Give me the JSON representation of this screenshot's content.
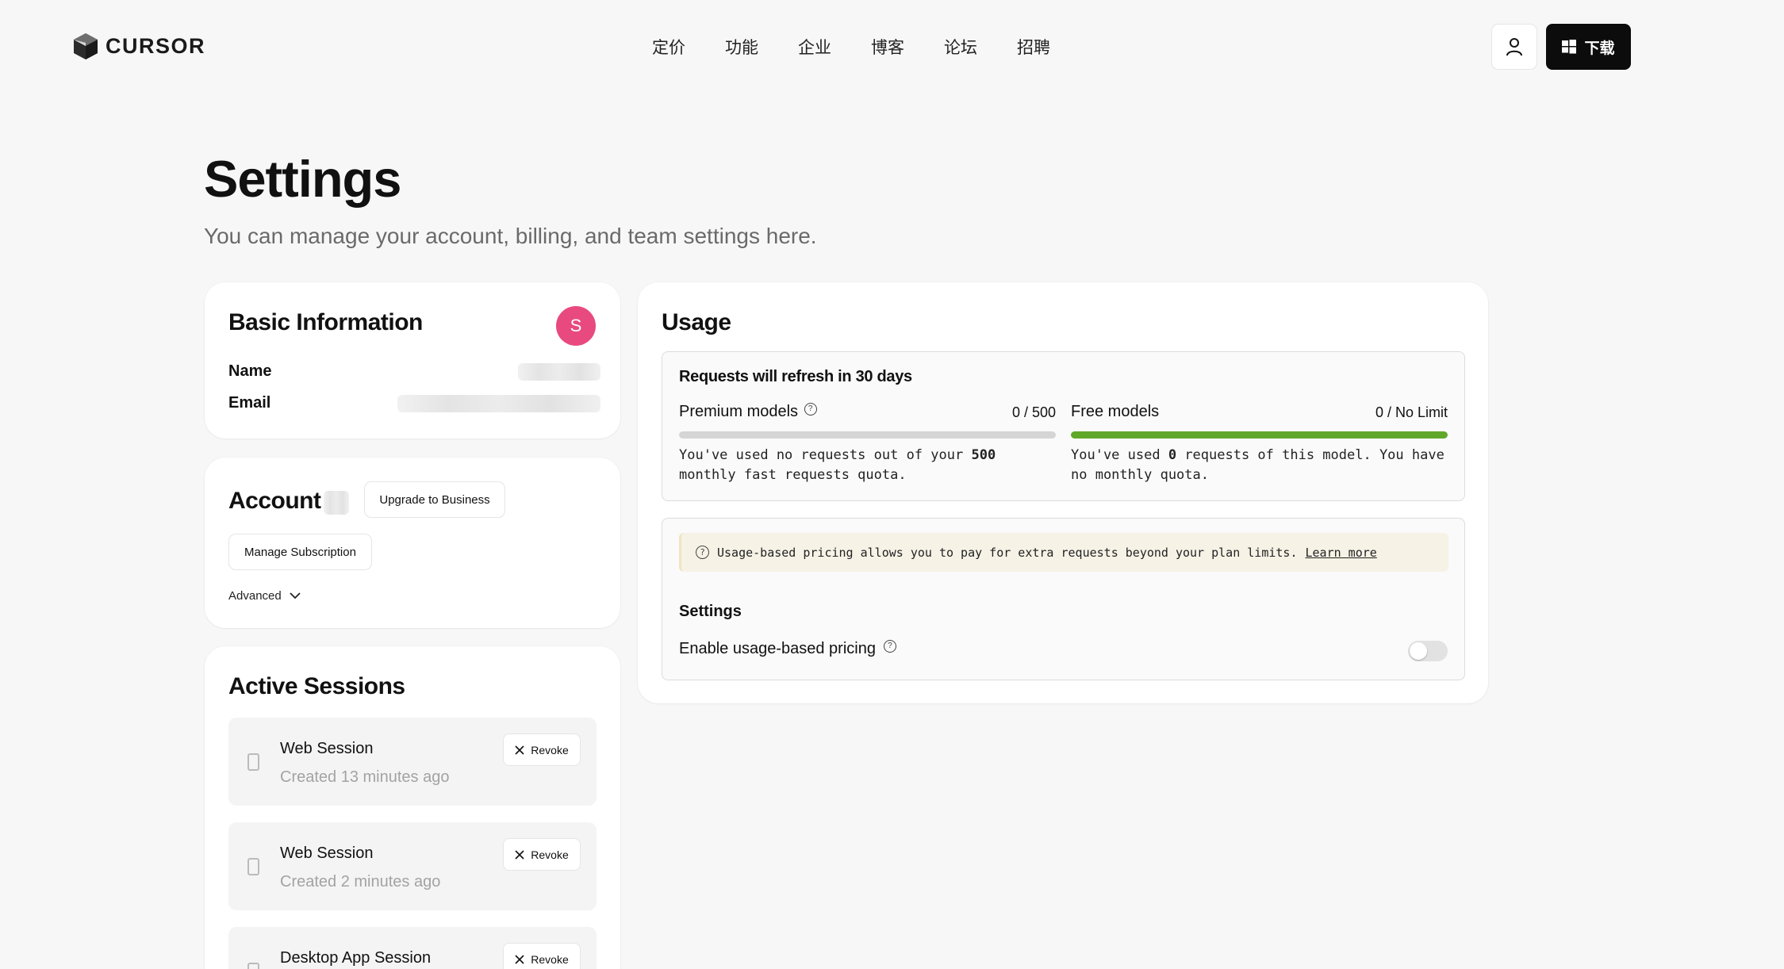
{
  "header": {
    "logo_text": "CURSOR",
    "nav": [
      "定价",
      "功能",
      "企业",
      "博客",
      "论坛",
      "招聘"
    ],
    "download_label": "下载",
    "icons": {
      "user": "user-icon",
      "windows": "windows-icon"
    }
  },
  "page": {
    "title": "Settings",
    "subtitle": "You can manage your account, billing, and team settings here."
  },
  "basic_info": {
    "title": "Basic Information",
    "avatar_letter": "S",
    "avatar_color": "#e84a7f",
    "name_label": "Name",
    "email_label": "Email"
  },
  "account": {
    "title": "Account",
    "upgrade_label": "Upgrade to Business",
    "manage_label": "Manage Subscription",
    "advanced_label": "Advanced"
  },
  "sessions": {
    "title": "Active Sessions",
    "revoke_label": "Revoke",
    "items": [
      {
        "name": "Web Session",
        "time": "Created 13 minutes ago"
      },
      {
        "name": "Web Session",
        "time": "Created 2 minutes ago"
      },
      {
        "name": "Desktop App Session",
        "time": ""
      }
    ]
  },
  "usage": {
    "title": "Usage",
    "refresh_text": "Requests will refresh in 30 days",
    "premium": {
      "label": "Premium models",
      "count": "0 / 500",
      "progress": 0,
      "desc_pre": "You've used no requests out of your ",
      "desc_bold": "500",
      "desc_post": " monthly fast requests quota."
    },
    "free": {
      "label": "Free models",
      "count": "0 / No Limit",
      "progress": 1,
      "bar_color": "#5fa82a",
      "desc_pre": "You've used ",
      "desc_bold": "0",
      "desc_post": " requests of this model. You have no monthly quota."
    },
    "notice_text": "Usage-based pricing allows you to pay for extra requests beyond your plan limits.",
    "notice_link": "Learn more",
    "settings_title": "Settings",
    "toggle_label": "Enable usage-based pricing",
    "toggle_on": false
  }
}
